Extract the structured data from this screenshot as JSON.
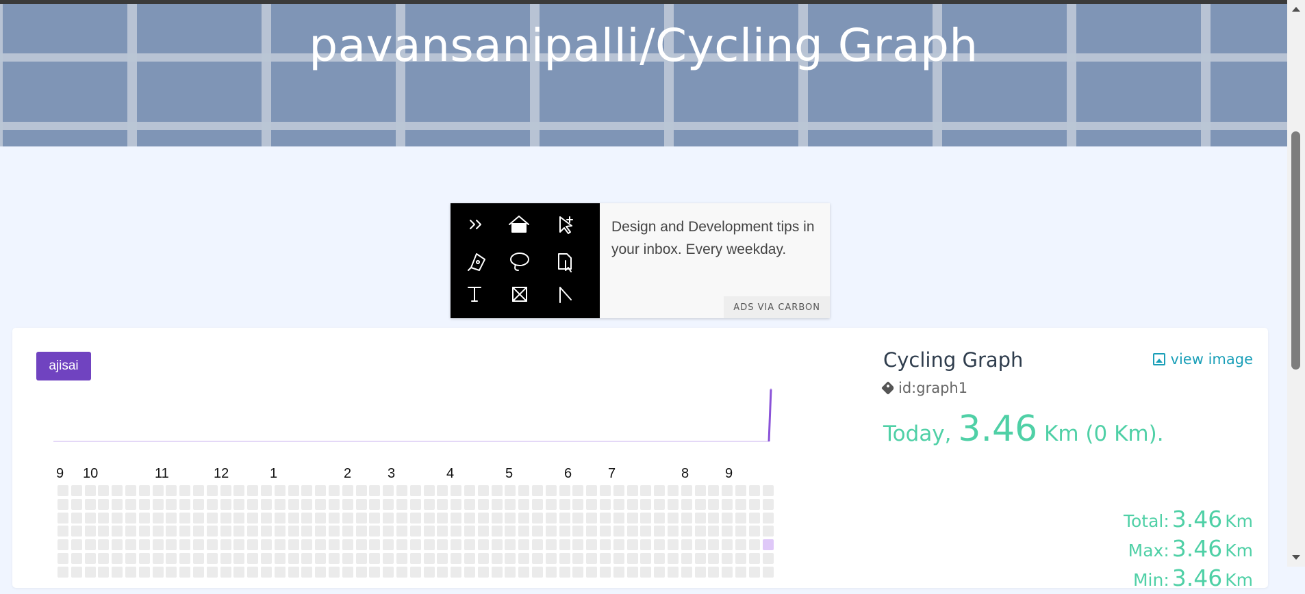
{
  "header": {
    "title": "pavansanipalli/Cycling Graph"
  },
  "ad": {
    "text": "Design and Development tips in your inbox. Every weekday.",
    "via": "ADS VIA CARBON",
    "icons": [
      "double-chevron-icon",
      "home-icon",
      "add-cursor-icon",
      "pen-tool-icon",
      "lasso-icon",
      "file-cursor-icon",
      "text-tool-icon",
      "frame-icon",
      "angle-icon"
    ]
  },
  "graph": {
    "theme_label": "ajisai",
    "month_labels": [
      "9",
      "10",
      "11",
      "12",
      "1",
      "2",
      "3",
      "4",
      "5",
      "6",
      "7",
      "8",
      "9"
    ],
    "accent": "#7043c0"
  },
  "info": {
    "title": "Cycling Graph",
    "view_image": "view image",
    "id": "id:graph1",
    "today_prefix": "Today,",
    "today_value": "3.46",
    "today_suffix": "Km (0 Km).",
    "stats": [
      {
        "label": "Total:",
        "value": "3.46",
        "unit": "Km"
      },
      {
        "label": "Max:",
        "value": "3.46",
        "unit": "Km"
      },
      {
        "label": "Min:",
        "value": "3.46",
        "unit": "Km"
      }
    ],
    "accent": "#4fd0a6"
  }
}
